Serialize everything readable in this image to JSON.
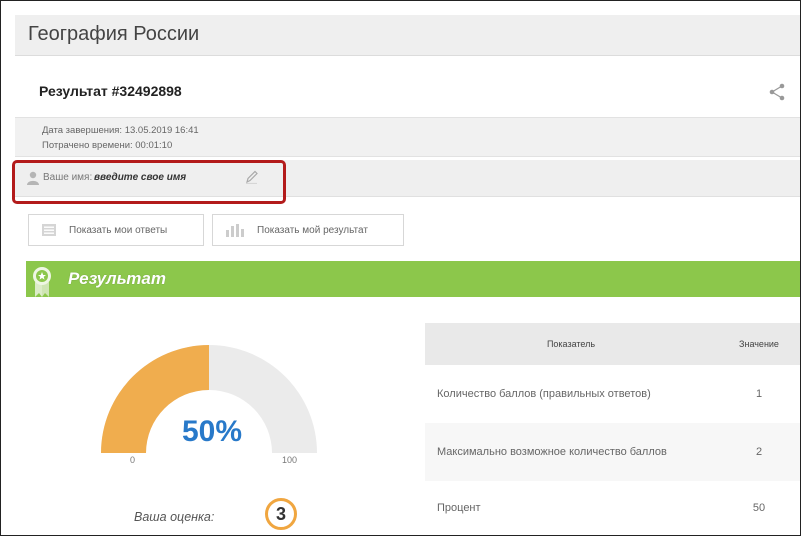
{
  "app": {
    "title": "География России"
  },
  "result": {
    "title": "Результат #32492898"
  },
  "meta": {
    "finished": "Дата завершения: 13.05.2019 16:41",
    "time_spent": "Потрачено времени: 00:01:10"
  },
  "user": {
    "name_label": "Ваше имя:",
    "name_value": "введите свое имя"
  },
  "buttons": {
    "show_answers": "Показать мои ответы",
    "show_result": "Показать мой результат"
  },
  "section": {
    "title": "Результат",
    "color": "#8cc74b"
  },
  "gauge": {
    "percent_text": "50%",
    "value": 50,
    "min": "0",
    "max": "100",
    "fill_color": "#f0ad4e",
    "bg_color": "#ebebeb"
  },
  "grade": {
    "label": "Ваша оценка:",
    "value": "3"
  },
  "table": {
    "headers": [
      "Показатель",
      "Значение"
    ],
    "rows": [
      {
        "label": "Количество баллов (правильных ответов)",
        "value": "1"
      },
      {
        "label": "Максимально возможное количество баллов",
        "value": "2"
      },
      {
        "label": "Процент",
        "value": "50"
      }
    ]
  },
  "icons": [
    "share-icon",
    "user-icon",
    "pencil-icon",
    "list-icon",
    "bar-chart-icon",
    "award-badge-icon"
  ]
}
